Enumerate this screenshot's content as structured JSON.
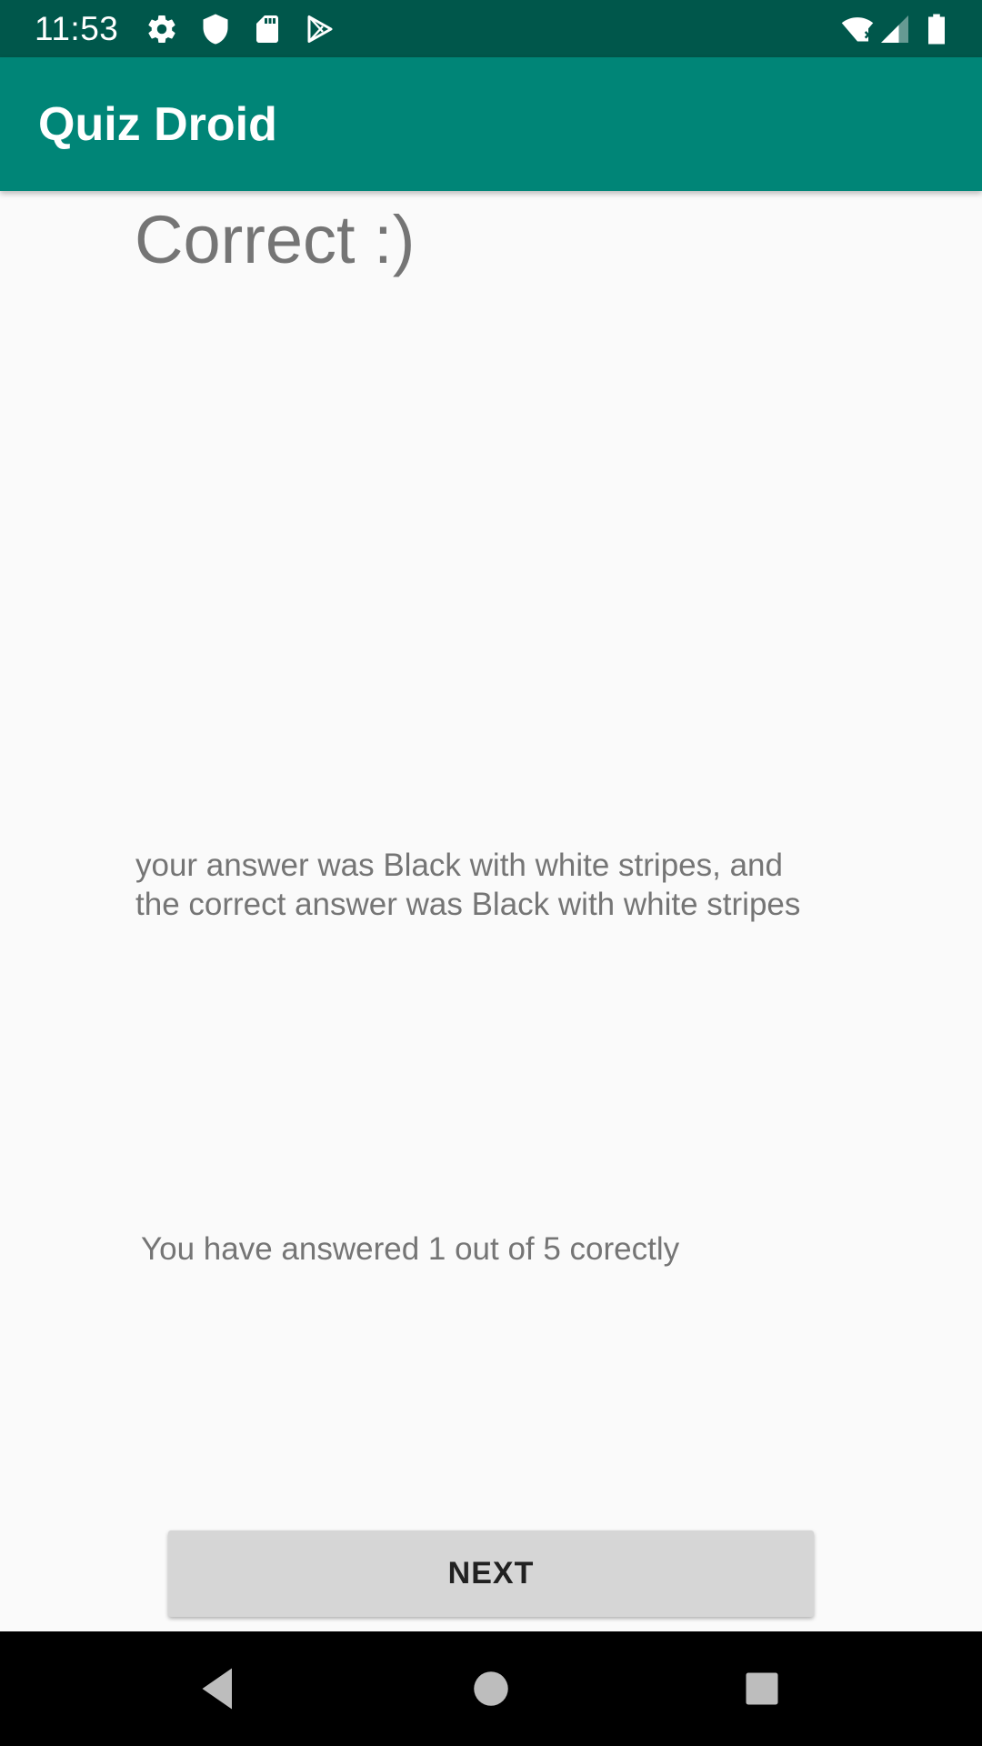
{
  "status_bar": {
    "time": "11:53",
    "background": "#00574b",
    "icons_left": [
      "gear-icon",
      "shield-icon",
      "sd-card-icon",
      "play-store-icon"
    ],
    "icons_right": [
      "wifi-icon",
      "signal-icon",
      "battery-icon"
    ]
  },
  "app_bar": {
    "title": "Quiz Droid",
    "background": "#008577"
  },
  "content": {
    "result_heading": "Correct :)",
    "answer_line_1": "your answer was Black with white stripes, and",
    "answer_line_2": "the correct answer was Black with white stripes",
    "score_text": "You have answered 1 out of 5 corectly"
  },
  "actions": {
    "next_label": "NEXT"
  },
  "nav_bar": {
    "buttons": [
      "back-icon",
      "home-icon",
      "recents-icon"
    ]
  }
}
